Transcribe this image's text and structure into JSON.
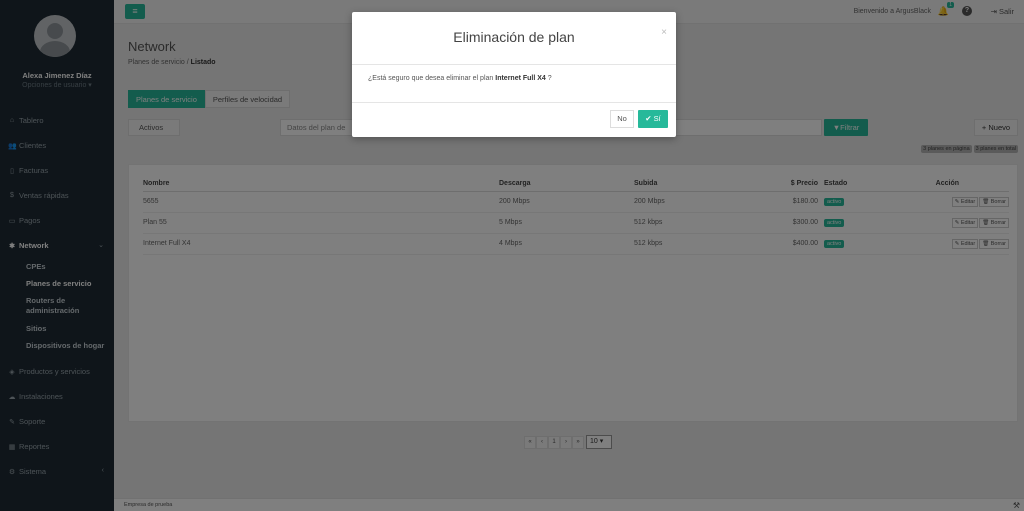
{
  "sidebar": {
    "user_name": "Alexa Jimenez Díaz",
    "user_options": "Opciones de usuario ▾",
    "items": [
      {
        "icon": "home-icon",
        "glyph": "⌂",
        "label": "Tablero"
      },
      {
        "icon": "users-icon",
        "glyph": "👥",
        "label": "Clientes"
      },
      {
        "icon": "file-icon",
        "glyph": "▯",
        "label": "Facturas"
      },
      {
        "icon": "dollar-icon",
        "glyph": "$",
        "label": "Ventas rápidas"
      },
      {
        "icon": "payment-icon",
        "glyph": "▭",
        "label": "Pagos"
      },
      {
        "icon": "network-icon",
        "glyph": "✱",
        "label": "Network"
      },
      {
        "icon": "tag-icon",
        "glyph": "◈",
        "label": "Productos y servicios"
      },
      {
        "icon": "install-icon",
        "glyph": "☁",
        "label": "Instalaciones"
      },
      {
        "icon": "wrench-icon",
        "glyph": "✎",
        "label": "Soporte"
      },
      {
        "icon": "report-icon",
        "glyph": "▦",
        "label": "Reportes"
      },
      {
        "icon": "cogs-icon",
        "glyph": "⚙",
        "label": "Sistema"
      }
    ],
    "network_sub": [
      "CPEs",
      "Planes de servicio",
      "Routers de administración",
      "Sitios",
      "Dispositivos de hogar"
    ]
  },
  "topbar": {
    "menu_glyph": "≡",
    "welcome": "Bienvenido a ArgusBlack",
    "notification_count": "1",
    "help_glyph": "?",
    "logout": "⇥ Salir"
  },
  "page": {
    "title": "Network",
    "breadcrumb_parent": "Planes de servicio",
    "breadcrumb_separator": "/",
    "breadcrumb_current": "Listado",
    "tabs": [
      "Planes de servicio",
      "Perfiles de velocidad"
    ],
    "status_filter": "Activos",
    "search_placeholder": "Datos del plan de",
    "filter_label": "▼Filtrar",
    "new_label": "+ Nuevo",
    "count_page": "3 planes en página",
    "count_total": "3 planes en total"
  },
  "table": {
    "columns": [
      "Nombre",
      "Descarga",
      "Subida",
      "$ Precio",
      "Estado",
      "Acción"
    ],
    "rows": [
      {
        "name": "5655",
        "down": "200 Mbps",
        "up": "200 Mbps",
        "price": "$180.00",
        "status": "activo"
      },
      {
        "name": "Plan 55",
        "down": "5 Mbps",
        "up": "512 kbps",
        "price": "$300.00",
        "status": "activo"
      },
      {
        "name": "Internet Full X4",
        "down": "4 Mbps",
        "up": "512 kbps",
        "price": "$400.00",
        "status": "activo"
      }
    ],
    "edit_label": "✎ Editar",
    "delete_label": "🗑 Borrar"
  },
  "pagination": {
    "first": "«",
    "prev": "‹",
    "current": "1",
    "next": "›",
    "last": "»",
    "page_size": "10 ▾"
  },
  "footer": {
    "text": "Empresa de prueba"
  },
  "modal": {
    "title": "Eliminación de plan",
    "close": "×",
    "message_prefix": "¿Está seguro que desea eliminar el plan",
    "plan_name": "Internet Full X4",
    "message_suffix": "?",
    "no_label": "No",
    "yes_label": "✔ Sí"
  },
  "colors": {
    "accent": "#26b99a",
    "sidebar_bg": "#1e2b34"
  }
}
